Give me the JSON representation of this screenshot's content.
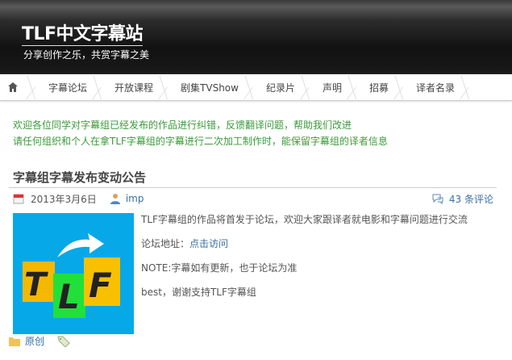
{
  "header": {
    "title": "TLF中文字幕站",
    "tagline": "分享创作之乐，共赏字幕之美"
  },
  "nav": {
    "items": [
      "字幕论坛",
      "开放课程",
      "剧集TVShow",
      "纪录片",
      "声明",
      "招募",
      "译者名录"
    ]
  },
  "notice": [
    "欢迎各位同学对字幕组已经发布的作品进行纠错，反馈翻译问题，帮助我们改进",
    "请任何组织和个人在拿TLF字幕组的字幕进行二次加工制作时，能保留字幕组的译者信息"
  ],
  "post": {
    "title": "字幕组字幕发布变动公告",
    "date": "2013年3月6日",
    "author": "imp",
    "comments": "43 条评论",
    "lines": [
      "TLF字幕组的作品将首发于论坛，欢迎大家跟译者就电影和字幕问题进行交流"
    ],
    "forum_label": "论坛地址：",
    "forum_link": "点击访问",
    "note": "NOTE:字幕如有更新，也于论坛为准",
    "thanks": "best，谢谢支持TLF字幕组",
    "category": "原创",
    "logo_text": "TLF"
  }
}
